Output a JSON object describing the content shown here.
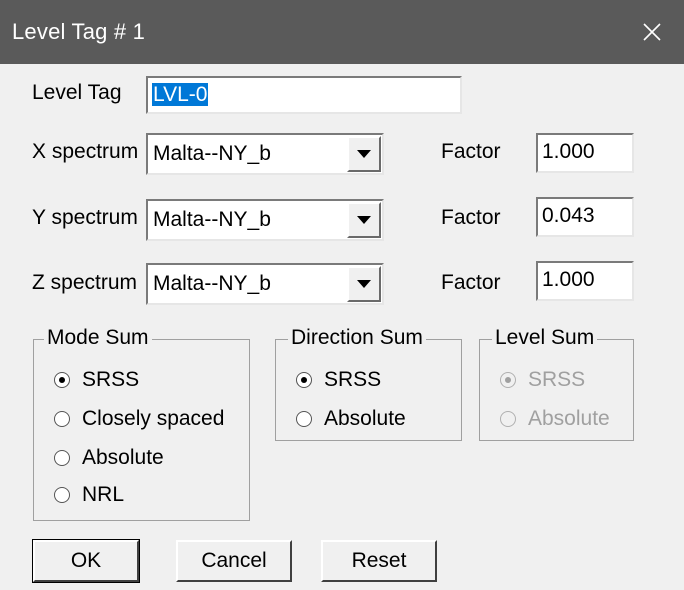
{
  "window": {
    "title": "Level Tag # 1",
    "close_icon": "close-icon"
  },
  "level_tag": {
    "label": "Level Tag",
    "value": "LVL-0"
  },
  "spectra": [
    {
      "label": "X spectrum",
      "selected": "Malta--NY_b",
      "factor_label": "Factor",
      "factor": "1.000"
    },
    {
      "label": "Y spectrum",
      "selected": "Malta--NY_b",
      "factor_label": "Factor",
      "factor": "0.043"
    },
    {
      "label": "Z spectrum",
      "selected": "Malta--NY_b",
      "factor_label": "Factor",
      "factor": "1.000"
    }
  ],
  "mode_sum": {
    "title": "Mode Sum",
    "options": [
      "SRSS",
      "Closely spaced",
      "Absolute",
      "NRL"
    ],
    "selected": "SRSS"
  },
  "direction_sum": {
    "title": "Direction Sum",
    "options": [
      "SRSS",
      "Absolute"
    ],
    "selected": "SRSS"
  },
  "level_sum": {
    "title": "Level Sum",
    "options": [
      "SRSS",
      "Absolute"
    ],
    "selected": "SRSS",
    "enabled": false
  },
  "buttons": {
    "ok": "OK",
    "cancel": "Cancel",
    "reset": "Reset"
  }
}
